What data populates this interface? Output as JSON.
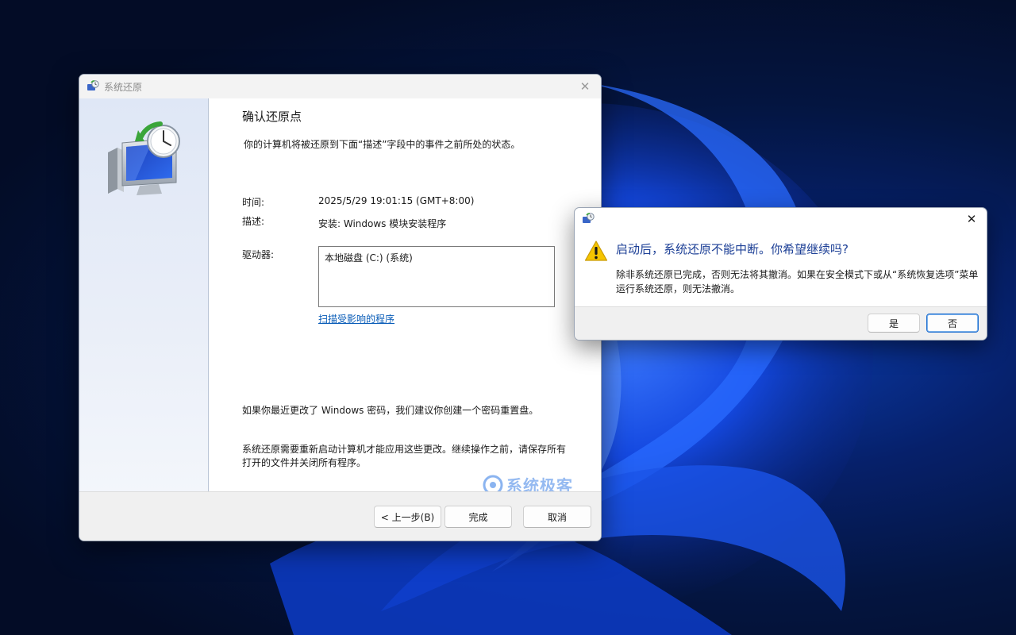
{
  "main_window": {
    "title": "系统还原",
    "heading": "确认还原点",
    "subtitle": "你的计算机将被还原到下面“描述”字段中的事件之前所处的状态。",
    "time_label": "时间:",
    "time_value": "2025/5/29 19:01:15 (GMT+8:00)",
    "desc_label": "描述:",
    "desc_value": "安装: Windows 模块安装程序",
    "drive_label": "驱动器:",
    "drive_value": "本地磁盘 (C:) (系统)",
    "scan_link": "扫描受影响的程序",
    "note_password": "如果你最近更改了 Windows 密码，我们建议你创建一个密码重置盘。",
    "note_restart_1": "系统还原需要重新启动计算机才能应用这些更改。继续操作之前，请保存所有",
    "note_restart_2": "打开的文件并关闭所有程序。",
    "watermark": "系统极客",
    "buttons": {
      "back": "< 上一步(B)",
      "finish": "完成",
      "cancel": "取消"
    }
  },
  "confirm_dialog": {
    "heading": "启动后，系统还原不能中断。你希望继续吗?",
    "body_1": "除非系统还原已完成，否则无法将其撤消。如果在安全模式下或从“系统恢复选项”菜单",
    "body_2": "运行系统还原，则无法撤消。",
    "buttons": {
      "yes": "是",
      "no": "否"
    }
  },
  "icons": {
    "app": "system-restore-icon",
    "warning": "warning-icon",
    "close": "close-icon"
  },
  "colors": {
    "link": "#0a5db8",
    "dialog_heading": "#1c3f96",
    "primary_button_border": "#1c6dd0"
  }
}
